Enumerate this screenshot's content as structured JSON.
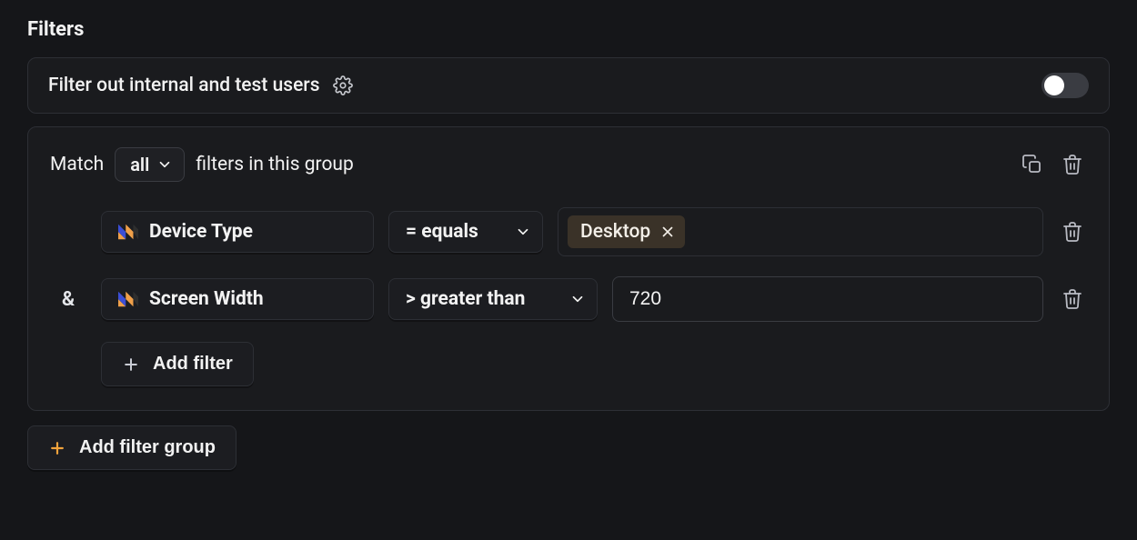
{
  "section_title": "Filters",
  "internal": {
    "label": "Filter out internal and test users",
    "toggle_on": false
  },
  "group": {
    "match_prefix": "Match",
    "match_mode": "all",
    "match_suffix": "filters in this group",
    "filters": [
      {
        "join": "",
        "property": "Device Type",
        "operator": "= equals",
        "value_chip": "Desktop"
      },
      {
        "join": "&",
        "property": "Screen Width",
        "operator": "> greater than",
        "value_text": "720"
      }
    ],
    "add_filter_label": "Add filter"
  },
  "add_group_label": "Add filter group"
}
